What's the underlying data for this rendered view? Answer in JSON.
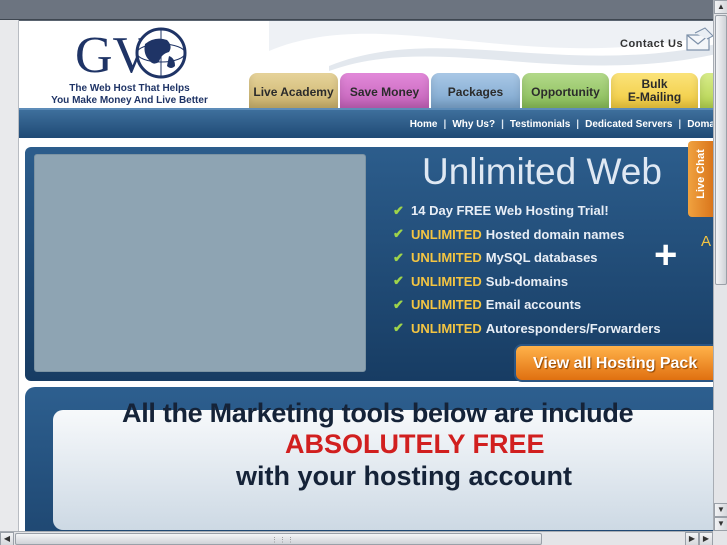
{
  "header": {
    "logo_alt": "GV",
    "tagline_line1": "The Web Host That Helps",
    "tagline_line2": "You Make Money And Live Better",
    "contact_label": "Contact Us"
  },
  "tabs": [
    {
      "label": "Live Academy"
    },
    {
      "label": "Save Money"
    },
    {
      "label": "Packages"
    },
    {
      "label": "Opportunity"
    },
    {
      "label_line1": "Bulk",
      "label_line2": "E-Mailing"
    }
  ],
  "nav": {
    "items": [
      "Home",
      "Why Us?",
      "Testimonials",
      "Dedicated Servers",
      "Doma"
    ],
    "separator": "|"
  },
  "hero": {
    "title": "Unlimited Web",
    "features": [
      {
        "highlight": "",
        "text": "14 Day FREE Web Hosting Trial!"
      },
      {
        "highlight": "UNLIMITED",
        "text": "Hosted domain names"
      },
      {
        "highlight": "UNLIMITED",
        "text": "MySQL databases"
      },
      {
        "highlight": "UNLIMITED",
        "text": "Sub-domains"
      },
      {
        "highlight": "UNLIMITED",
        "text": "Email accounts"
      },
      {
        "highlight": "UNLIMITED",
        "text": "Autoresponders/Forwarders"
      }
    ],
    "plus": "+",
    "partial": "A",
    "button_label": "View all Hosting Pack",
    "live_chat": "Live Chat"
  },
  "marketing": {
    "line1": "All the Marketing tools below are include",
    "line2": "ABSOLUTELY FREE",
    "line3": "with your hosting account"
  },
  "colors": {
    "accent_orange": "#e07010",
    "brand_blue": "#1f4a75",
    "highlight_yellow": "#f4c542",
    "free_red": "#d11f1f"
  }
}
